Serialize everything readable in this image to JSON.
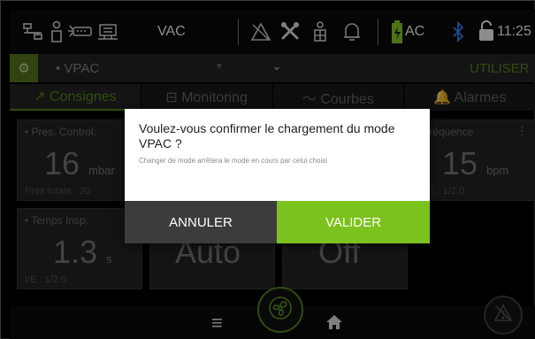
{
  "status_bar": {
    "mode_label": "VAC",
    "power_label": "AC",
    "time": "11:25",
    "icons": [
      "network-icon",
      "patient-icon",
      "sensor-icon",
      "device-icon",
      "alarm-off-icon",
      "tools-icon",
      "lock-patient-icon",
      "bell-off-icon",
      "battery-icon",
      "bluetooth-icon",
      "lock-icon"
    ]
  },
  "mode_bar": {
    "mode_name": "• VPAC",
    "use_label": "UTILISER"
  },
  "tabs": [
    {
      "label": "↗ Consignes",
      "active": true
    },
    {
      "label": "⊟ Monitoring",
      "active": false
    },
    {
      "label": "〜 Courbes",
      "active": false
    },
    {
      "label": "🔔 Alarmes",
      "active": false
    }
  ],
  "tiles": {
    "pres_control": {
      "label": "• Pres. Control.",
      "value": "16",
      "unit": "mbar",
      "sub": "Pres totale : 20"
    },
    "frequence": {
      "label": "Fréquence",
      "value": "15",
      "unit": "bpm",
      "sub": "I/E : 1/2.0"
    },
    "temps_insp": {
      "label": "• Temps Insp.",
      "value": "1.3",
      "unit": "s",
      "sub": "I/E : 1/2.0"
    },
    "tile2": {
      "value": "Auto"
    },
    "tile3": {
      "value": "Off"
    }
  },
  "dialog": {
    "title": "Voulez-vous confirmer le chargement du mode VPAC ?",
    "subtitle": "Changer de mode arrêtera le mode en cours par celui choisi",
    "cancel_label": "ANNULER",
    "confirm_label": "VALIDER"
  },
  "colors": {
    "accent": "#7cc21e",
    "cancel_bg": "#3c3c3c"
  }
}
